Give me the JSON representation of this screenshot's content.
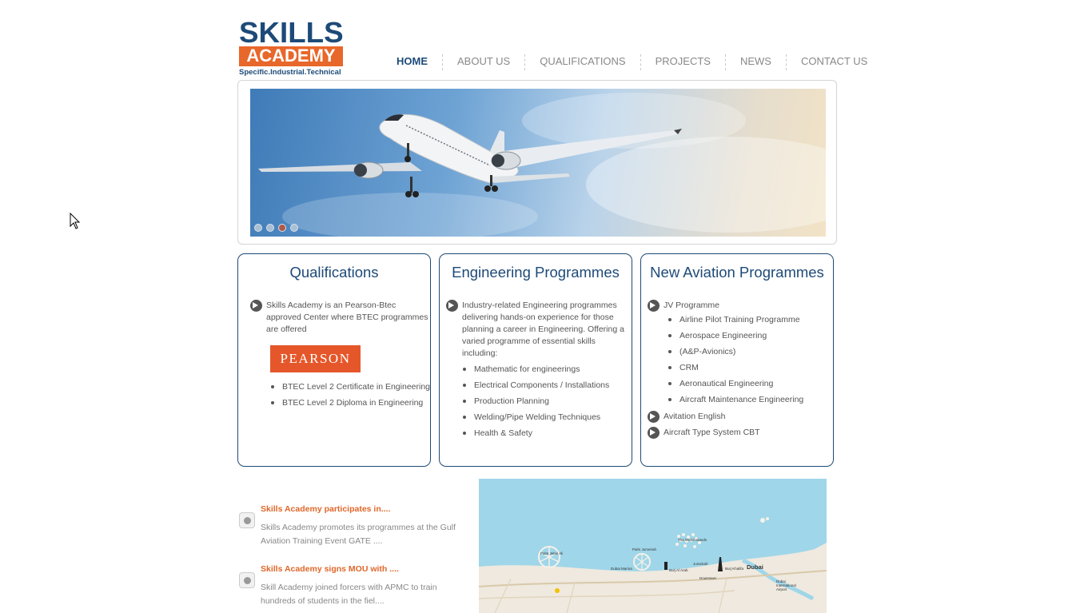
{
  "logo": {
    "line1": "SKILLS",
    "line2": "ACADEMY",
    "tagline": "Specific.Industrial.Technical"
  },
  "nav": {
    "items": [
      "HOME",
      "ABOUT US",
      "QUALIFICATIONS",
      "PROJECTS",
      "NEWS",
      "CONTACT US"
    ],
    "active": "HOME"
  },
  "slider": {
    "slide_count": 4,
    "active_slide": 3
  },
  "qualifications": {
    "title": "Qualifications",
    "intro": "Skills Academy is an Pearson-Btec approved Center where BTEC programmes are offered",
    "badge": "PEARSON",
    "items": [
      "BTEC Level 2 Certificate in Engineering",
      "BTEC Level 2 Diploma in Engineering"
    ]
  },
  "engineering": {
    "title": "Engineering Programmes",
    "intro": "Industry-related Engineering programmes delivering hands-on experience for those planning a career in Engineering. Offering a varied programme of essential skills including:",
    "items": [
      "Mathematic for engineerings",
      "Electrical Components / Installations",
      "Production Planning",
      "Welding/Pipe Welding Techniques",
      "Health & Safety"
    ]
  },
  "aviation": {
    "title": "New Aviation Programmes",
    "group1": "JV Programme",
    "items": [
      "Airline Pilot Training Programme",
      "Aerospace Engineering",
      "(A&P-Avionics)",
      "CRM",
      "Aeronautical Engineering",
      "Aircraft Maintenance Engineering"
    ],
    "group2": "Avitation English",
    "group3": "Aircraft Type System CBT"
  },
  "news": [
    {
      "title": "Skills Academy participates in....",
      "desc": "Skills Academy promotes its programmes at the Gulf Aviation Training Event GATE ...."
    },
    {
      "title": "Skills Academy signs MOU with ....",
      "desc": "Skill Academy joined forcers with APMC to train hundreds of students in the fiel...."
    }
  ],
  "map": {
    "labels": [
      "Palm Jebel Ali",
      "Palm Jumeirah",
      "The World Islands",
      "Dubai Marina",
      "Burj Al Arab",
      "Jumeirah",
      "Burj Khalifa",
      "Downtown",
      "Dubai",
      "Dubai International Airport"
    ]
  },
  "colors": {
    "brand_blue": "#1d4a78",
    "brand_orange": "#e8672a",
    "map_sea": "#9fd6e9"
  }
}
